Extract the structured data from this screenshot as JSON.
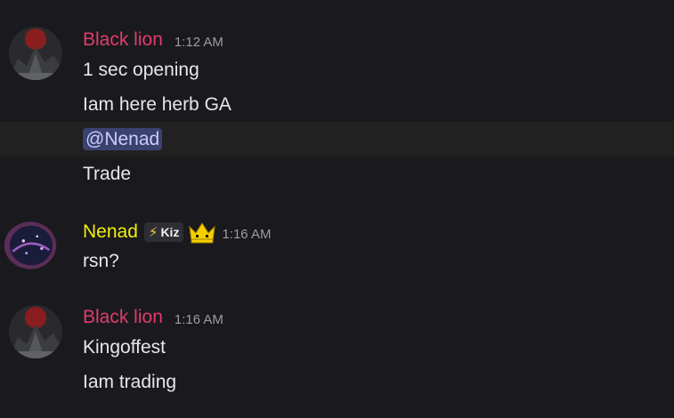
{
  "groups": [
    {
      "author": "Black lion",
      "time": "1:12 AM",
      "messages": [
        "1 sec opening",
        "Iam here herb GA",
        "Trade"
      ],
      "mention": "@Nenad"
    },
    {
      "author": "Nenad",
      "tag": "Kiz",
      "time": "1:16 AM",
      "messages": [
        "rsn?"
      ]
    },
    {
      "author": "Black lion",
      "time": "1:16 AM",
      "messages": [
        "Kingoffest",
        "Iam trading"
      ]
    }
  ],
  "colors": {
    "background": "#1a1a1e",
    "black_lion_name": "#e03c6b",
    "nenad_name": "#f2ef0c",
    "mention_bg": "#3c4270",
    "highlight_row": "#222121"
  },
  "icons": {
    "tag_icon": "lightning-bolt-icon",
    "crown": "crown-icon"
  }
}
